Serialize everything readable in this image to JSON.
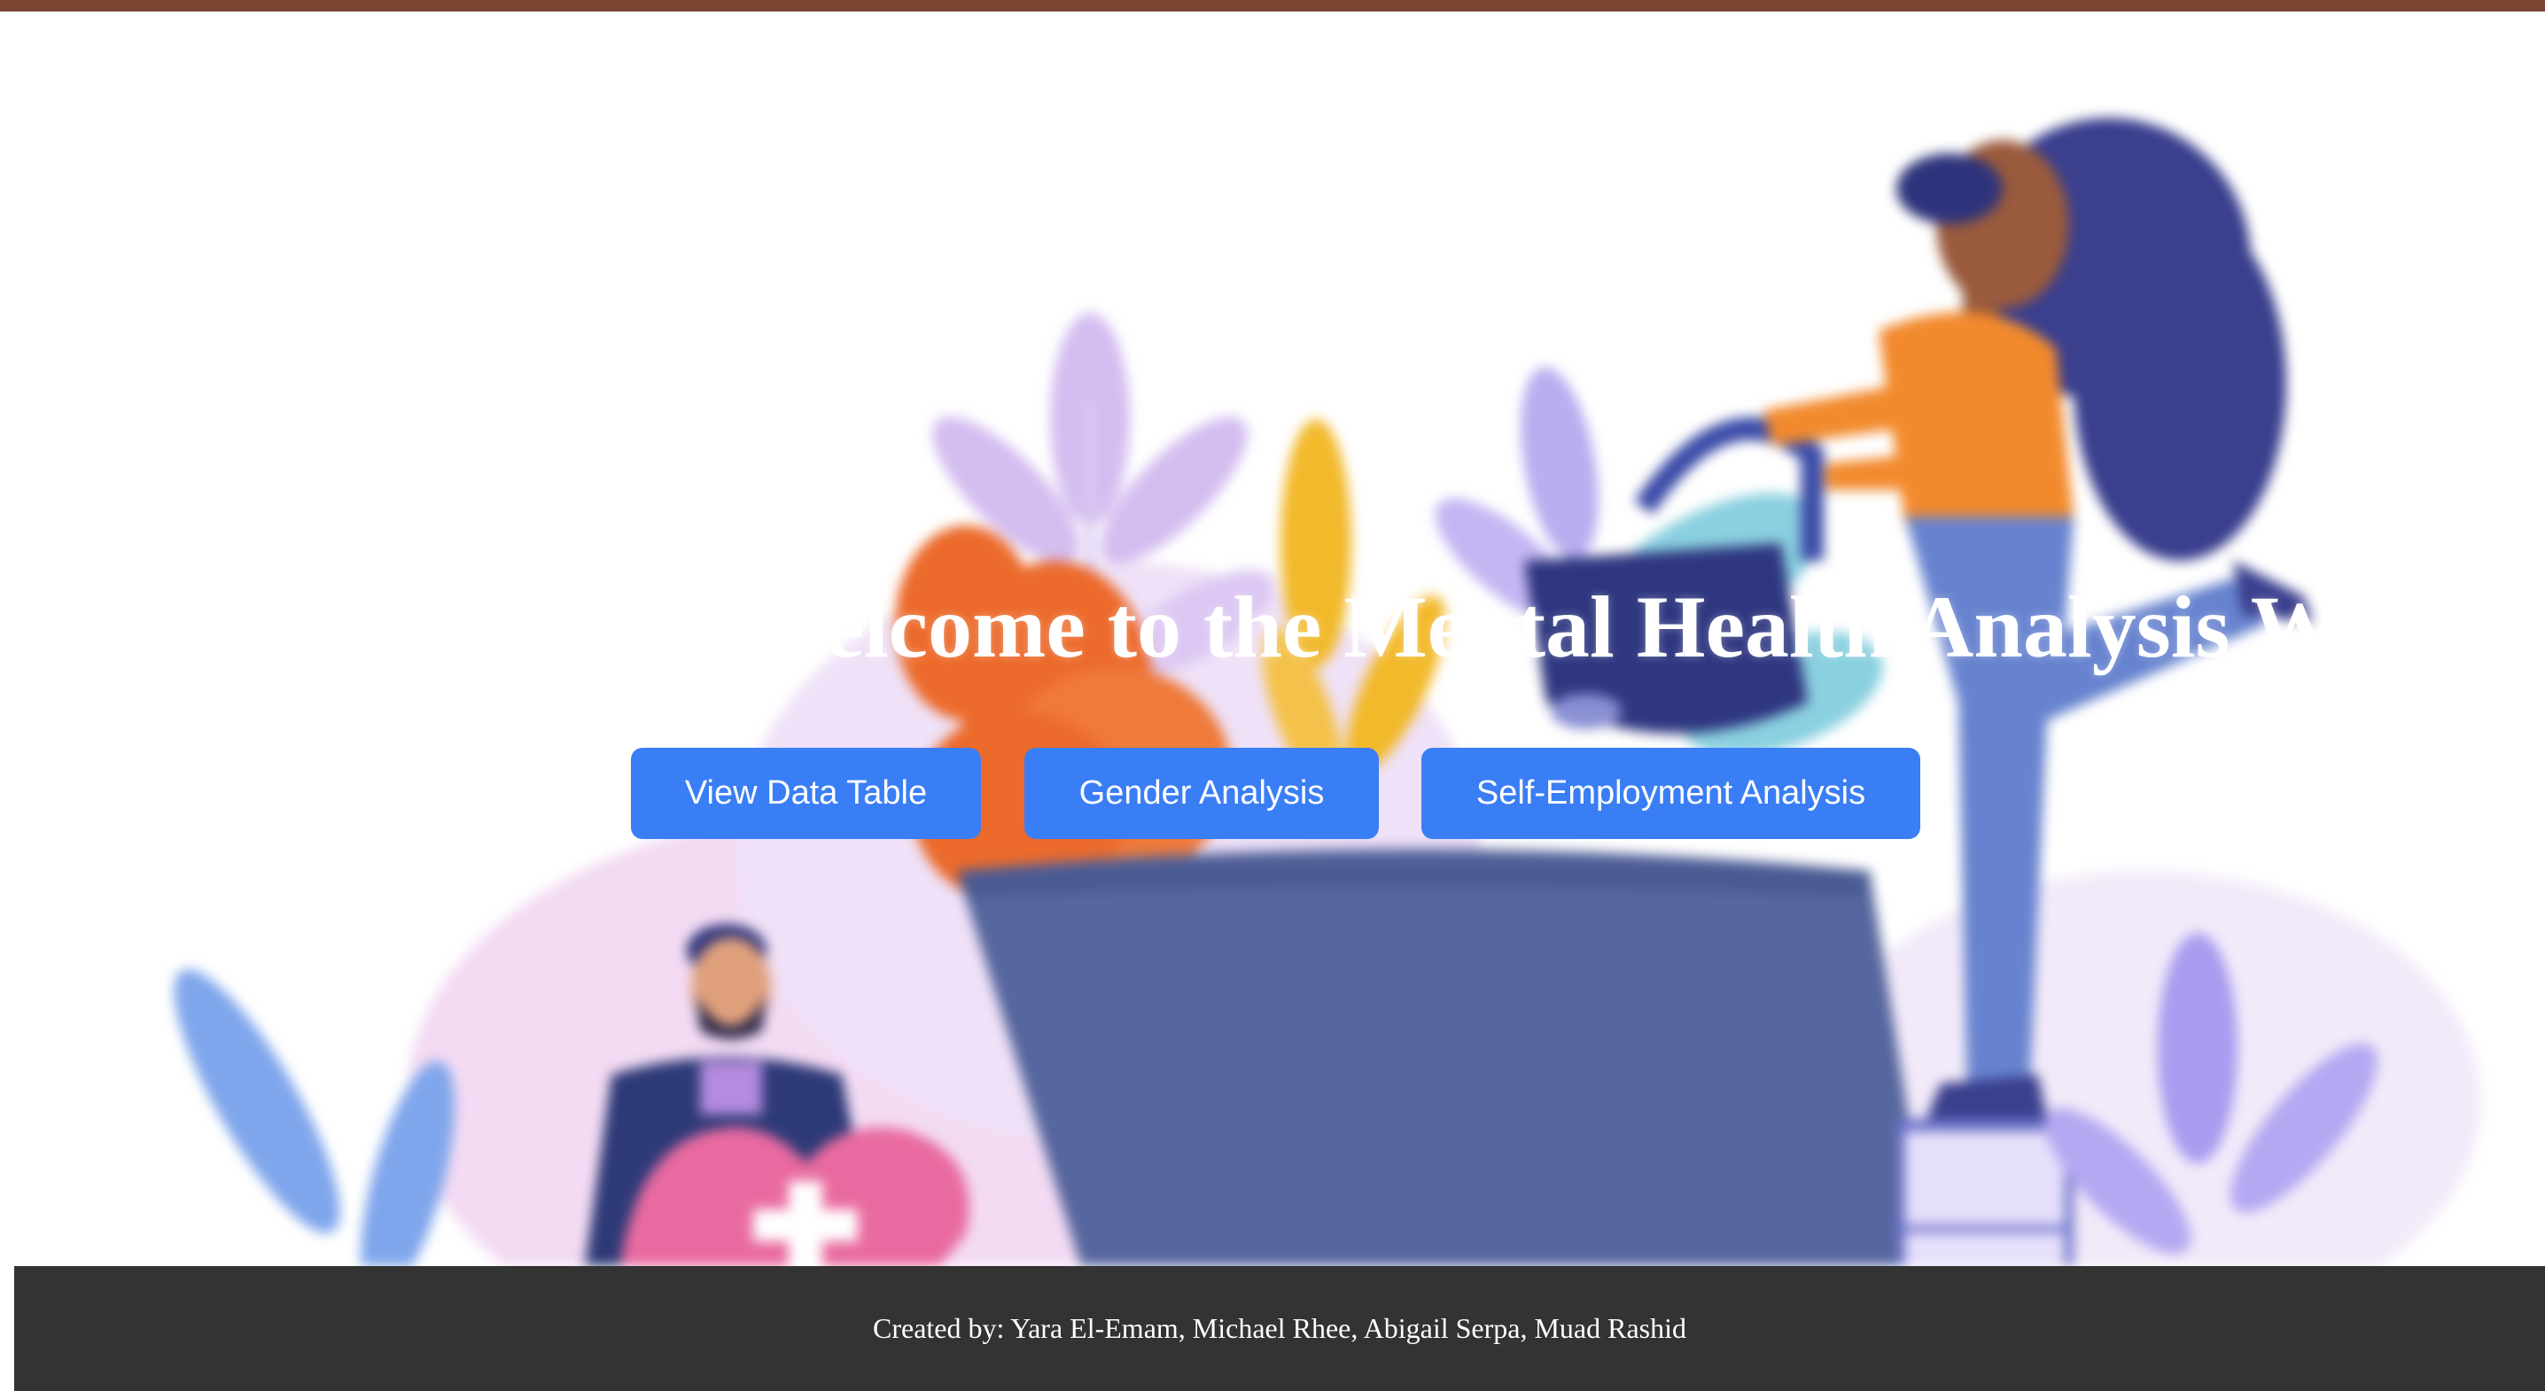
{
  "hero": {
    "title": "Welcome to the Mental Health Analysis Web App",
    "illustration_icon": "mental-health-illustration"
  },
  "nav": {
    "view_data_table": "View Data Table",
    "gender_analysis": "Gender Analysis",
    "self_employment_analysis": "Self-Employment Analysis"
  },
  "footer": {
    "credits": "Created by: Yara El-Emam, Michael Rhee, Abigail Serpa, Muad Rashid"
  },
  "colors": {
    "top_bar": "#7d4634",
    "button": "#3a7ef5",
    "footer": "#333333"
  }
}
